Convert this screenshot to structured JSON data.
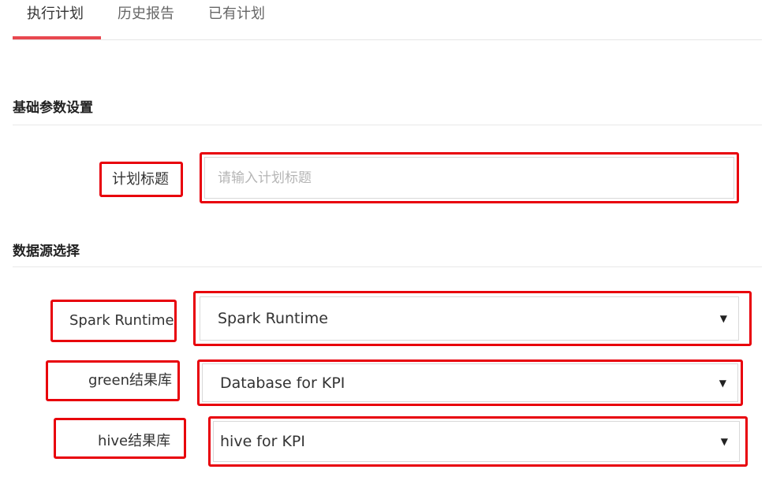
{
  "tabs": [
    {
      "label": "执行计划",
      "active": true
    },
    {
      "label": "历史报告",
      "active": false
    },
    {
      "label": "已有计划",
      "active": false
    }
  ],
  "sections": {
    "basic": {
      "title": "基础参数设置"
    },
    "datasource": {
      "title": "数据源选择"
    }
  },
  "form": {
    "plan_title": {
      "label": "计划标题",
      "placeholder": "请输入计划标题",
      "value": ""
    },
    "spark_runtime": {
      "label": "Spark Runtime",
      "selected": "Spark Runtime"
    },
    "green_db": {
      "label": "green结果库",
      "selected": "Database for KPI"
    },
    "hive_db": {
      "label": "hive结果库",
      "selected": "hive for KPI"
    }
  },
  "icons": {
    "dropdown": "caret-down-icon"
  },
  "colors": {
    "accent": "#e8474f",
    "annotation": "#e8000b"
  }
}
